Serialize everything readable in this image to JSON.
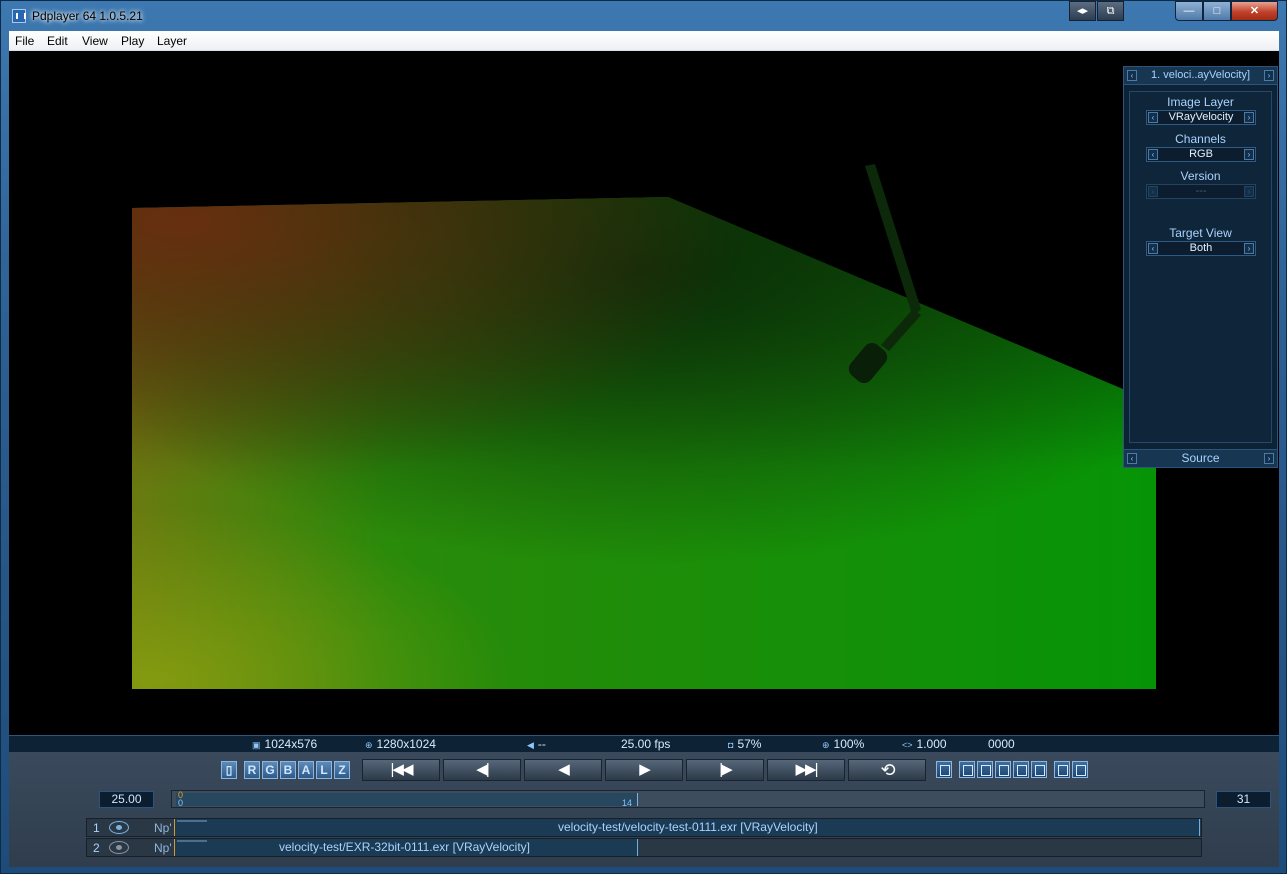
{
  "window": {
    "title": "Pdplayer 64 1.0.5.21",
    "min": "—",
    "max": "□",
    "close": "✕"
  },
  "menu": [
    "File",
    "Edit",
    "View",
    "Play",
    "Layer"
  ],
  "panel": {
    "layer_name": "1. veloci..ayVelocity]",
    "image_layer_label": "Image Layer",
    "image_layer_value": "VRayVelocity",
    "channels_label": "Channels",
    "channels_value": "RGB",
    "version_label": "Version",
    "version_value": "---",
    "target_view_label": "Target View",
    "target_view_value": "Both",
    "footer": "Source"
  },
  "status": {
    "image_size": "1024x576",
    "screen_size": "1280x1024",
    "audio": "--",
    "fps": "25.00 fps",
    "cache": "57%",
    "zoom": "100%",
    "aspect": "1.000",
    "frame": "0000"
  },
  "channels": [
    "R",
    "G",
    "B",
    "A",
    "L",
    "Z"
  ],
  "transport": {
    "first": "|◀◀",
    "step_back": "◀|",
    "play_back": "◀",
    "play": "▶",
    "step_fwd": "|▶",
    "last": "▶▶|",
    "loop": "⟲"
  },
  "timeline": {
    "fps_value": "25.00",
    "start_top": "0",
    "start_bottom": "0",
    "current": "14",
    "end_value": "31",
    "progress": 0.45
  },
  "layers": [
    {
      "num": "1",
      "np": "Np'",
      "name": "velocity-test/velocity-test-0111.exr [VRayVelocity]"
    },
    {
      "num": "2",
      "np": "Np'",
      "name": "velocity-test/EXR-32bit-0111.exr [VRayVelocity]"
    }
  ]
}
